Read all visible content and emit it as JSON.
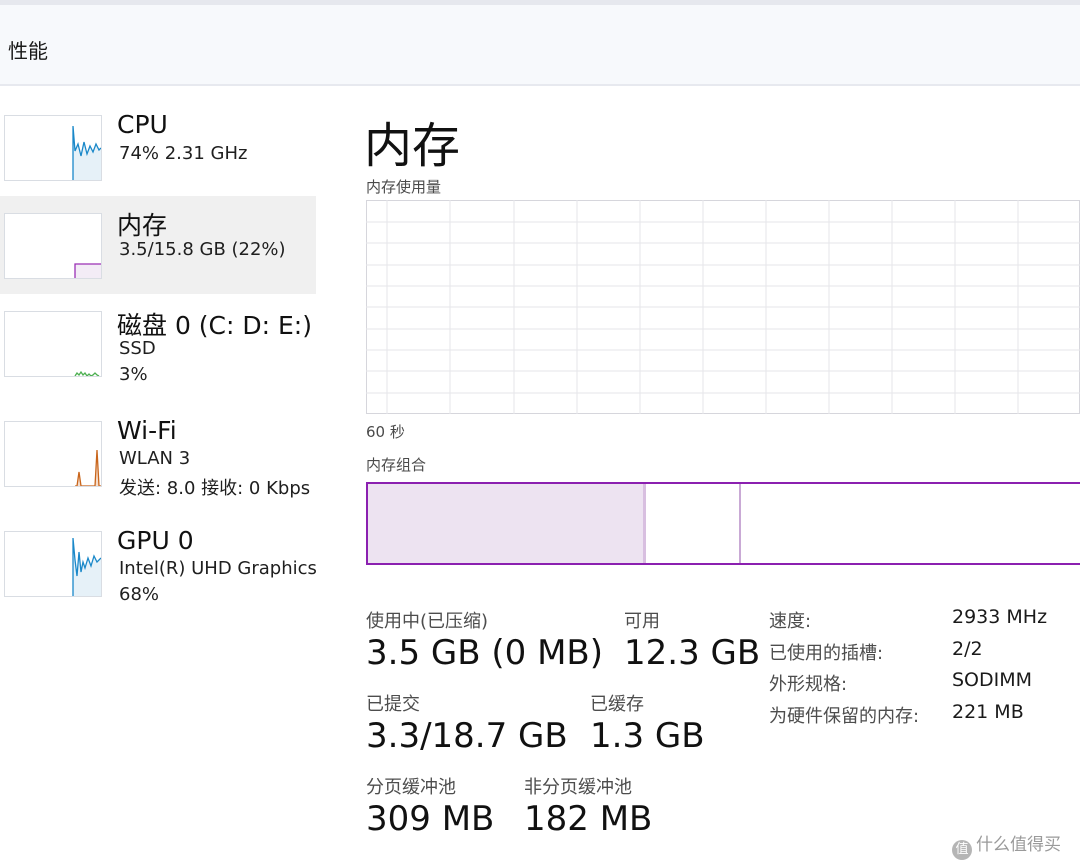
{
  "header": {
    "title": "性能"
  },
  "sidebar": {
    "items": [
      {
        "name": "CPU",
        "sub1": "74%  2.31 GHz",
        "sub2": "",
        "color": "#1a88c9"
      },
      {
        "name": "内存",
        "sub1": "3.5/15.8 GB (22%)",
        "sub2": "",
        "color": "#9a2fb5",
        "selected": true
      },
      {
        "name": "磁盘 0 (C: D: E:)",
        "sub1": "SSD",
        "sub2": "3%",
        "color": "#4caf50"
      },
      {
        "name": "Wi-Fi",
        "sub1": "WLAN 3",
        "sub2": "发送: 8.0  接收: 0 Kbps",
        "color": "#c9651b"
      },
      {
        "name": "GPU 0",
        "sub1": "Intel(R) UHD Graphics",
        "sub2": "68%",
        "color": "#1a88c9"
      }
    ]
  },
  "main": {
    "title": "内存",
    "usage_graph_label": "内存使用量",
    "time_label": "60 秒",
    "composition_label": "内存组合",
    "composition": {
      "in_use_fraction": 0.385,
      "modified_fraction": 0.005,
      "standby_fraction": 0.135
    },
    "stats": {
      "in_use_label": "使用中(已压缩)",
      "in_use_value": "3.5 GB (0 MB)",
      "available_label": "可用",
      "available_value": "12.3 GB",
      "committed_label": "已提交",
      "committed_value": "3.3/18.7 GB",
      "cached_label": "已缓存",
      "cached_value": "1.3 GB",
      "paged_pool_label": "分页缓冲池",
      "paged_pool_value": "309 MB",
      "nonpaged_pool_label": "非分页缓冲池",
      "nonpaged_pool_value": "182 MB"
    },
    "details": [
      {
        "label": "速度:",
        "value": "2933 MHz"
      },
      {
        "label": "已使用的插槽:",
        "value": "2/2"
      },
      {
        "label": "外形规格:",
        "value": "SODIMM"
      },
      {
        "label": "为硬件保留的内存:",
        "value": "221 MB"
      }
    ]
  },
  "colors": {
    "memory_accent": "#8b20b0",
    "memory_fill": "#ede3f1",
    "grid": "#e6e6ea"
  },
  "watermark": {
    "text": "什么值得买",
    "icon": "zhi-logo"
  }
}
